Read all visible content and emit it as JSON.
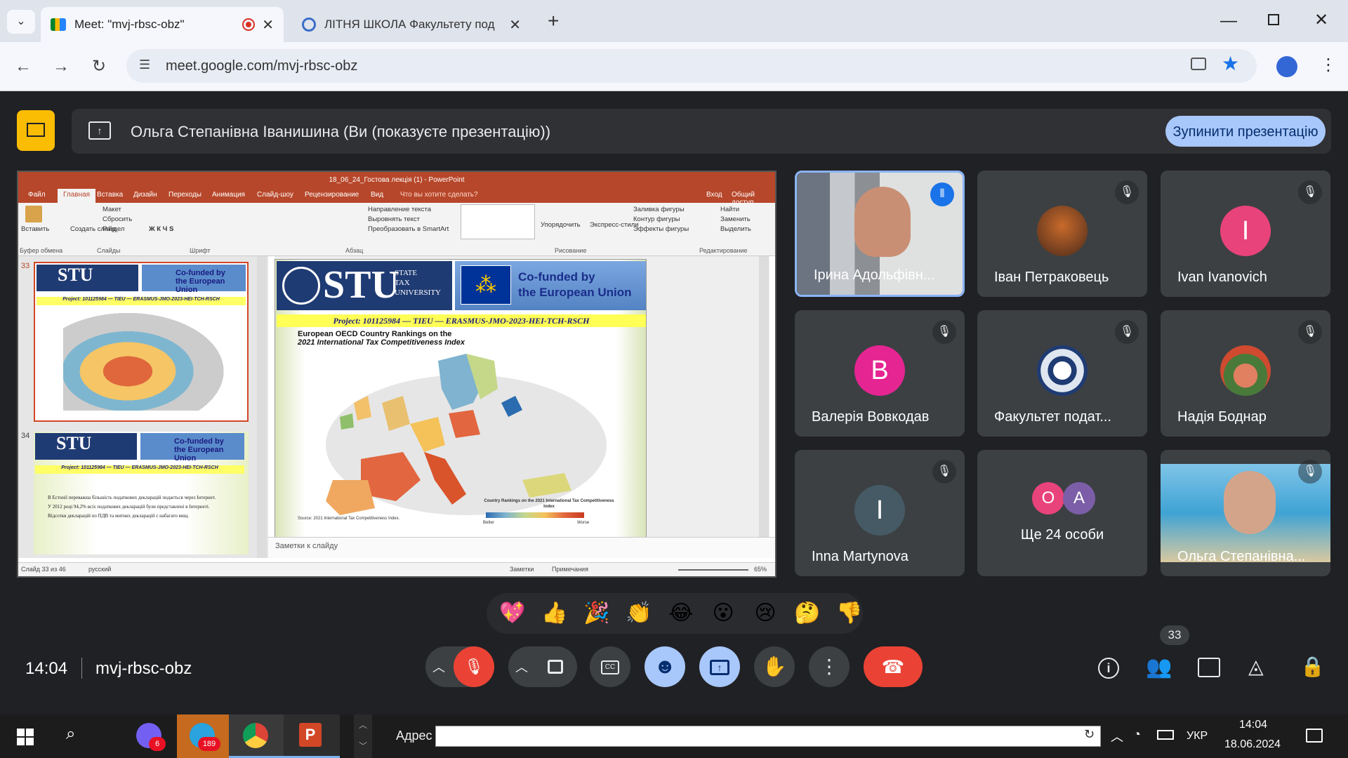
{
  "browser": {
    "tabs": [
      {
        "title": "Meet: \"mvj-rbsc-obz\"",
        "active": true
      },
      {
        "title": "ЛІТНЯ ШКОЛА Факультету под",
        "active": false
      }
    ],
    "url": "meet.google.com/mvj-rbsc-obz"
  },
  "meet": {
    "presenting_text": "Ольга Степанівна Іванишина (Ви (показуєте презентацію))",
    "stop_button": "Зупинити презентацію",
    "participants": [
      {
        "name": "Ірина Адольфівн...",
        "type": "video"
      },
      {
        "name": "Іван Петраковець",
        "type": "image"
      },
      {
        "name": "Ivan Ivanovich",
        "initial": "I",
        "color": "#e8437a"
      },
      {
        "name": "Валерія Вовкодав",
        "initial": "В",
        "color": "#e52592"
      },
      {
        "name": "Факультет подат...",
        "type": "image"
      },
      {
        "name": "Надія Боднар",
        "type": "image"
      },
      {
        "name": "Inna Martynova",
        "initial": "I",
        "color": "#455a64"
      },
      {
        "name": "Ще 24 особи",
        "initials": [
          "О",
          "А"
        ],
        "colors": [
          "#e8437a",
          "#7b5ea7"
        ]
      },
      {
        "name": "Ольга Степанівна...",
        "type": "video"
      }
    ],
    "reactions": [
      "💖",
      "👍",
      "🎉",
      "👏",
      "😂",
      "😮",
      "😢",
      "🤔",
      "👎"
    ],
    "time": "14:04",
    "meeting_code": "mvj-rbsc-obz",
    "people_count": "33"
  },
  "powerpoint": {
    "title": "18_06_24_Гостова лекція (1) - PowerPoint",
    "tabs": [
      "Файл",
      "Главная",
      "Вставка",
      "Дизайн",
      "Переходы",
      "Анимация",
      "Слайд-шоу",
      "Рецензирование",
      "Вид",
      "Что вы хотите сделать?"
    ],
    "login": "Вход",
    "share": "Общий доступ",
    "ribbon": {
      "paste": "Вставить",
      "create_slide": "Создать слайд",
      "layout": "Макет",
      "reset": "Сбросить",
      "section": "Раздел",
      "text_direction": "Направление текста",
      "align_text": "Выровнять текст",
      "smartart": "Преобразовать в SmartArt",
      "arrange": "Упорядочить",
      "express_styles": "Экспресс-стили",
      "shape_fill": "Заливка фигуры",
      "shape_outline": "Контур фигуры",
      "shape_effects": "Эффекты фигуры",
      "find": "Найти",
      "replace": "Заменить",
      "select": "Выделить",
      "groups": [
        "Буфер обмена",
        "Слайды",
        "Шрифт",
        "Абзац",
        "Рисование",
        "Редактирование"
      ]
    },
    "slide_numbers": [
      "33",
      "34"
    ],
    "slide": {
      "university": "STU",
      "university_line1": "STATE",
      "university_line2": "TAX",
      "university_line3": "UNIVERSITY",
      "eu_line1": "Co-funded by",
      "eu_line2": "the European Union",
      "project": "Project: 101125984 — TIEU — ERASMUS-JMO-2023-HEI-TCH-RSCH",
      "map_title_1": "European OECD Country Rankings on the",
      "map_title_2": "2021 International Tax Competitiveness Index",
      "legend_title": "Country Rankings on the 2021 International Tax Competitiveness Index",
      "legend_better": "Better",
      "legend_worse": "Worse",
      "source": "Source: 2021 International Tax Competitiveness Index."
    },
    "thumb34_text": [
      "В Естонії переважна більшість податкових декларацій подається через Інтернет.",
      "У 2012 році 94,2% всіх податкових декларацій були представлені в Інтернеті.",
      "Відсоткв декларацій по ПДВ та митних декларацій є набагато вищ."
    ],
    "notes": "Заметки к слайду",
    "status_slide": "Слайд 33 из 46",
    "status_lang": "русский",
    "status_notes": "Заметки",
    "status_comments": "Примечания",
    "zoom": "65%"
  },
  "taskbar": {
    "address_label": "Адрес",
    "lang": "УКР",
    "time": "14:04",
    "date": "18.06.2024",
    "badges": {
      "viber": "6",
      "telegram": "189"
    }
  }
}
